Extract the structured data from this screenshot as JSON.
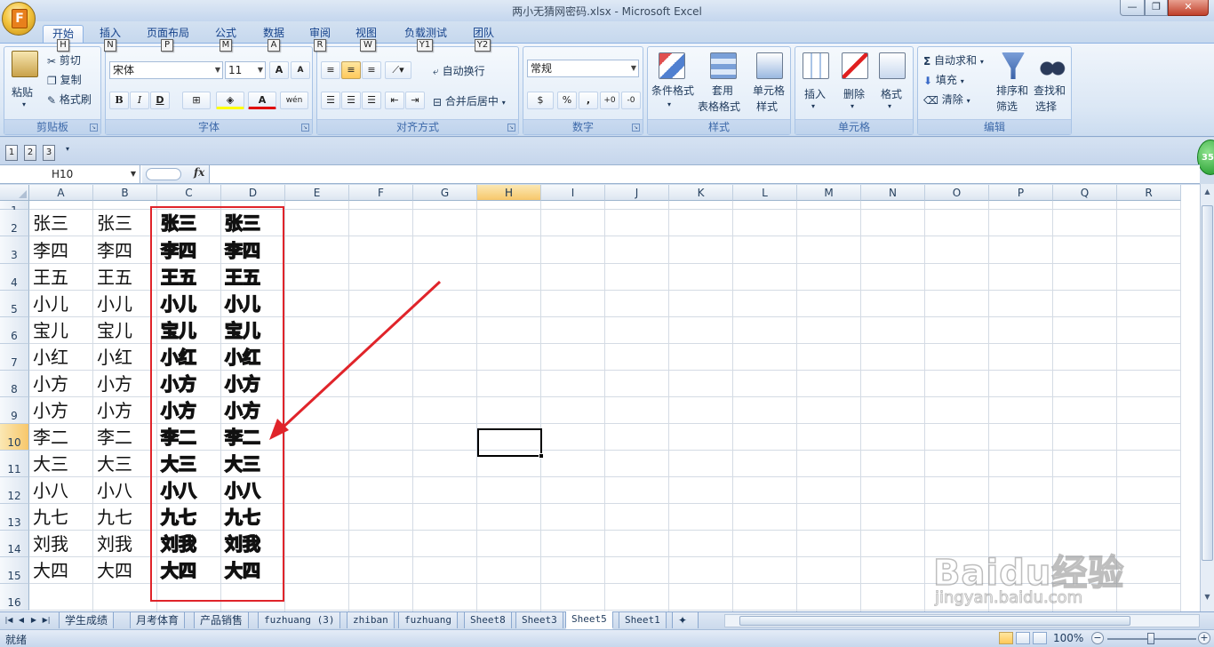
{
  "window": {
    "title": "两小无猜网密码.xlsx - Microsoft Excel",
    "office_logo_letter": "F",
    "controls": [
      "—",
      "❐",
      "✕"
    ]
  },
  "ribbon_tabs": [
    {
      "label": "开始",
      "keytip": "H",
      "active": true
    },
    {
      "label": "插入",
      "keytip": "N"
    },
    {
      "label": "页面布局",
      "keytip": "P"
    },
    {
      "label": "公式",
      "keytip": "M"
    },
    {
      "label": "数据",
      "keytip": "A"
    },
    {
      "label": "审阅",
      "keytip": "R"
    },
    {
      "label": "视图",
      "keytip": "W"
    },
    {
      "label": "负载测试",
      "keytip": "Y1"
    },
    {
      "label": "团队",
      "keytip": "Y2"
    }
  ],
  "help_controls": "? — ❐ ✕",
  "ribbon": {
    "clipboard": {
      "label": "剪贴板",
      "paste": "粘贴",
      "cut": "剪切",
      "copy": "复制",
      "format_painter": "格式刷"
    },
    "font": {
      "label": "字体",
      "font_name": "宋体",
      "font_size": "11",
      "grow": "A",
      "shrink": "A",
      "bold": "B",
      "italic": "I",
      "underline": "D",
      "border": "⊞",
      "fill": "◈",
      "font_color": "A",
      "phonetic": "wén"
    },
    "alignment": {
      "label": "对齐方式",
      "wrap_text": "自动换行",
      "merge_center": "合并后居中"
    },
    "number": {
      "label": "数字",
      "format": "常规",
      "currency": "$",
      "percent": "%",
      "comma": ",",
      "inc_decimal": "+0",
      "dec_decimal": "-0"
    },
    "styles": {
      "label": "样式",
      "conditional": "条件格式",
      "table_a": "套用",
      "table_b": "表格格式",
      "cell_style_a": "单元格",
      "cell_style_b": "样式"
    },
    "cells": {
      "label": "单元格",
      "insert": "插入",
      "delete": "删除",
      "format": "格式"
    },
    "editing": {
      "label": "编辑",
      "autosum": "自动求和",
      "fill": "填充",
      "clear": "清除",
      "sort_a": "排序和",
      "sort_b": "筛选",
      "find_a": "查找和",
      "find_b": "选择"
    }
  },
  "qat": {
    "items": [
      "1",
      "2",
      "3"
    ],
    "badge": "35"
  },
  "formula_bar": {
    "name_box": "H10",
    "fx": "fx",
    "content": ""
  },
  "columns": [
    "A",
    "B",
    "C",
    "D",
    "E",
    "F",
    "G",
    "H",
    "I",
    "J",
    "K",
    "L",
    "M",
    "N",
    "O",
    "P",
    "Q",
    "R"
  ],
  "selected_column": "H",
  "rows": [
    {
      "num": "1",
      "a": "",
      "b": "",
      "c": "",
      "d": ""
    },
    {
      "num": "2",
      "a": "张三",
      "b": "张三",
      "c": "张三",
      "d": "张三"
    },
    {
      "num": "3",
      "a": "李四",
      "b": "李四",
      "c": "李四",
      "d": "李四"
    },
    {
      "num": "4",
      "a": "王五",
      "b": "王五",
      "c": "王五",
      "d": "王五"
    },
    {
      "num": "5",
      "a": "小儿",
      "b": "小儿",
      "c": "小儿",
      "d": "小儿"
    },
    {
      "num": "6",
      "a": "宝儿",
      "b": "宝儿",
      "c": "宝儿",
      "d": "宝儿"
    },
    {
      "num": "7",
      "a": "小红",
      "b": "小红",
      "c": "小红",
      "d": "小红"
    },
    {
      "num": "8",
      "a": "小方",
      "b": "小方",
      "c": "小方",
      "d": "小方"
    },
    {
      "num": "9",
      "a": "小方",
      "b": "小方",
      "c": "小方",
      "d": "小方"
    },
    {
      "num": "10",
      "a": "李二",
      "b": "李二",
      "c": "李二",
      "d": "李二"
    },
    {
      "num": "11",
      "a": "大三",
      "b": "大三",
      "c": "大三",
      "d": "大三"
    },
    {
      "num": "12",
      "a": "小八",
      "b": "小八",
      "c": "小八",
      "d": "小八"
    },
    {
      "num": "13",
      "a": "九七",
      "b": "九七",
      "c": "九七",
      "d": "九七"
    },
    {
      "num": "14",
      "a": "刘我",
      "b": "刘我",
      "c": "刘我",
      "d": "刘我"
    },
    {
      "num": "15",
      "a": "大四",
      "b": "大四",
      "c": "大四",
      "d": "大四"
    },
    {
      "num": "16",
      "a": "",
      "b": "",
      "c": "",
      "d": ""
    }
  ],
  "selected_row": "10",
  "annotation_color": "#e0242a",
  "sheets": [
    {
      "name": "学生成绩"
    },
    {
      "name": "月考体育"
    },
    {
      "name": "产品销售"
    },
    {
      "name": "fuzhuang (3)",
      "mono": true
    },
    {
      "name": "zhiban",
      "mono": true
    },
    {
      "name": "fuzhuang",
      "mono": true
    },
    {
      "name": "Sheet8",
      "mono": true
    },
    {
      "name": "Sheet3",
      "mono": true
    },
    {
      "name": "Sheet5",
      "mono": true,
      "active": true
    },
    {
      "name": "Sheet1",
      "mono": true
    }
  ],
  "status": {
    "ready": "就绪",
    "zoom": "100%",
    "zoom_minus": "−",
    "zoom_plus": "+"
  },
  "watermark": {
    "line1": "Baidu经验",
    "line2": "jingyan.baidu.com"
  }
}
